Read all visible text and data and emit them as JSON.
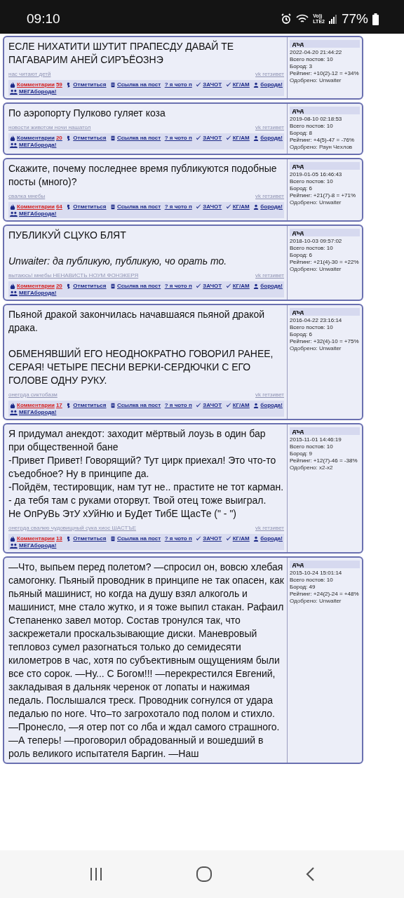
{
  "status_bar": {
    "time": "09:10",
    "volte": "Vo))",
    "network": "LTE2",
    "battery": "77%"
  },
  "posts": [
    {
      "paragraphs": [
        [
          {
            "kind": "line",
            "text": "ЕСЛЕ НИХАТИТИ ШУТИТ ПРАПЕСДУ ДАВАЙ ТЕ ПАГАВАРИМ АНЕЙ СИРЪЁОЗНЭ"
          }
        ]
      ],
      "tags": "нас читают детй",
      "share": "vk гетзивет",
      "comments": {
        "label": "Комментарии",
        "count": "59",
        "hot": true
      },
      "actions": [
        "Отметиться",
        "Ссылка на пост",
        "? я чото п",
        "ЗАЧОТ",
        "КГ/АМ",
        "борода!",
        "МЕГАборода!"
      ],
      "author": "дъд",
      "date": "2022-04-20 21:44:22",
      "posts_total": "Всего постов: 10",
      "beards": "Бород: 3",
      "rating": "Рейтинг: +10(2)-12 = +34%",
      "approved": "Одобрено: Unwaiter"
    },
    {
      "paragraphs": [
        [
          {
            "kind": "line",
            "text": "По аэропорту Пулково гуляет коза"
          }
        ]
      ],
      "tags": "новости животом ночи нашатол",
      "share": "vk гетзивет",
      "comments": {
        "label": "Комментарии",
        "count": "20",
        "hot": false
      },
      "actions": [
        "Отметиться",
        "Ссылка на пост",
        "? я чото п",
        "ЗАЧОТ",
        "КГ/АМ",
        "борода!",
        "МЕГАборода!"
      ],
      "author": "дъд",
      "date": "2019-08-10 02:18:53",
      "posts_total": "Всего постов: 10",
      "beards": "Бород: 8",
      "rating": "Рейтинг: +4(5)-47 = -76%",
      "approved": "Одобрено: Раун Чехлов"
    },
    {
      "paragraphs": [
        [
          {
            "kind": "line",
            "text": "Скажите, почему последнее время публикуются подобные посты (много)?"
          }
        ]
      ],
      "tags": "свалка мнебы",
      "share": "vk гетзивет",
      "comments": {
        "label": "Комментарии",
        "count": "64",
        "hot": true
      },
      "actions": [
        "Отметиться",
        "Ссылка на пост",
        "? я чото п",
        "ЗАЧОТ",
        "КГ/АМ",
        "борода!",
        "МЕГАборода!"
      ],
      "author": "дъд",
      "date": "2019-01-05 16:46:43",
      "posts_total": "Всего постов: 10",
      "beards": "Бород: 6",
      "rating": "Рейтинг: +21(7)-8 = +71%",
      "approved": "Одобрено: Unwaiter"
    },
    {
      "paragraphs": [
        [
          {
            "kind": "line",
            "text": "ПУБЛИКУЙ СЦУКО БЛЯТ"
          }
        ],
        [
          {
            "kind": "quote",
            "text": "Unwaiter: да публикую, публикую, чо орать то."
          }
        ]
      ],
      "tags": "вытаюсь! мнебы НЕНАВИСТЬ НОУМ ФОНЭКЕРЯ",
      "share": "vk гетзивет",
      "comments": {
        "label": "Комментарии",
        "count": "20",
        "hot": true
      },
      "actions": [
        "Отметиться",
        "Ссылка на пост",
        "? я чото п",
        "ЗАЧОТ",
        "КГ/АМ",
        "борода!",
        "МЕГАборода!"
      ],
      "author": "дъд",
      "date": "2018-10-03 09:57:02",
      "posts_total": "Всего постов: 10",
      "beards": "Бород: 6",
      "rating": "Рейтинг: +21(4)-30 = +22%",
      "approved": "Одобрено: Unwaiter"
    },
    {
      "paragraphs": [
        [
          {
            "kind": "line",
            "text": "Пьяной дракой закончилась начавшаяся пьяной дракой драка."
          }
        ],
        [
          {
            "kind": "line",
            "text": "ОБМЕНЯВШИЙ ЕГО НЕОДНОКРАТНО ГОВОРИЛ РАНЕЕ, СЕРАЯ! ЧЕТЫРЕ ПЕСНИ ВЕРКИ-СЕРДЮЧКИ С ЕГО ГОЛОВЕ ОДНУ РУКУ."
          }
        ]
      ],
      "tags": "онегрда сиктобазм",
      "share": "vk гетзивет",
      "comments": {
        "label": "Комментарии",
        "count": "17",
        "hot": true
      },
      "actions": [
        "Отметиться",
        "Ссылка на пост",
        "? я чото п",
        "ЗАЧОТ",
        "КГ/АМ",
        "борода!",
        "МЕГАборода!"
      ],
      "author": "дъд",
      "date": "2016-04-22 23:16:14",
      "posts_total": "Всего постов: 10",
      "beards": "Бород: 6",
      "rating": "Рейтинг: +32(4)-10 = +75%",
      "approved": "Одобрено: Unwaiter"
    },
    {
      "paragraphs": [
        [
          {
            "kind": "line",
            "text": "Я придумал анекдот: заходит мёртвый лоузь в один бар при общественной бане"
          },
          {
            "kind": "line",
            "text": "-Привет Привет! Говорящий? Тут цирк приехал! Это что-то съедобное? Ну в принципе да."
          },
          {
            "kind": "line",
            "text": "-Пойдём, тестировщик, нам тут не.. прастите не тот карман."
          },
          {
            "kind": "line",
            "text": "- да тебя там с руками оторвут. Твой отец тоже выиграл."
          },
          {
            "kind": "line",
            "text": "Не ОпРуВь ЭтУ хУйНю и БуДет ТибЕ ЩасТе (\" - \")"
          }
        ]
      ],
      "tags": "онегрда свалкю чудовищный сука хиос ШАСТЪЕ",
      "share": "vk гетзивет",
      "comments": {
        "label": "Комментарии",
        "count": "13",
        "hot": true
      },
      "actions": [
        "Отметиться",
        "Ссылка на пост",
        "? я чото п",
        "ЗАЧОТ",
        "КГ/АМ",
        "борода!",
        "МЕГАборода!"
      ],
      "author": "дъд",
      "date": "2015-11-01 14:46:19",
      "posts_total": "Всего постов: 10",
      "beards": "Бород: 9",
      "rating": "Рейтинг: +12(7)-46 = -38%",
      "approved": "Одобрено: x2-x2"
    },
    {
      "paragraphs": [
        [
          {
            "kind": "line",
            "text": "—Что, выпьем перед полетом? —спросил он, вовсю хлебая самогонку. Пьяный проводник в принципе не так опасен, как пьяный машинист, но когда на душу взял алкоголь и машинист, мне стало жутко, и я тоже выпил стакан. Рафаил Степаненко завел мотор. Состав тронулся так, что заскрежетали проскальзывающие диски. Маневровый тепловоз сумел разогнаться только до семидесяти километров в час, хотя по субъективным ощущениям были все сто сорок. —Ну... С Богом!!! —перекрестился Евгений, закладывая в дальняк черенок от лопаты и нажимая педаль. Послышался треск. Проводник согнулся от удара педалью по ноге. Что–то загрохотало под полом и стихло. —Пронесло, —я отер пот со лба и ждал самого страшного. —А теперь! —проговорил обрадованный и вошедший в роль великого испытателя Баргин. —Наш"
          }
        ]
      ],
      "author": "дъд",
      "date": "2015-10-24 15:01:14",
      "posts_total": "Всего постов: 10",
      "beards": "Бород: 49",
      "rating": "Рейтинг: +24(2)-24 = +48%",
      "approved": "Одобрено: Unwaiter"
    }
  ]
}
